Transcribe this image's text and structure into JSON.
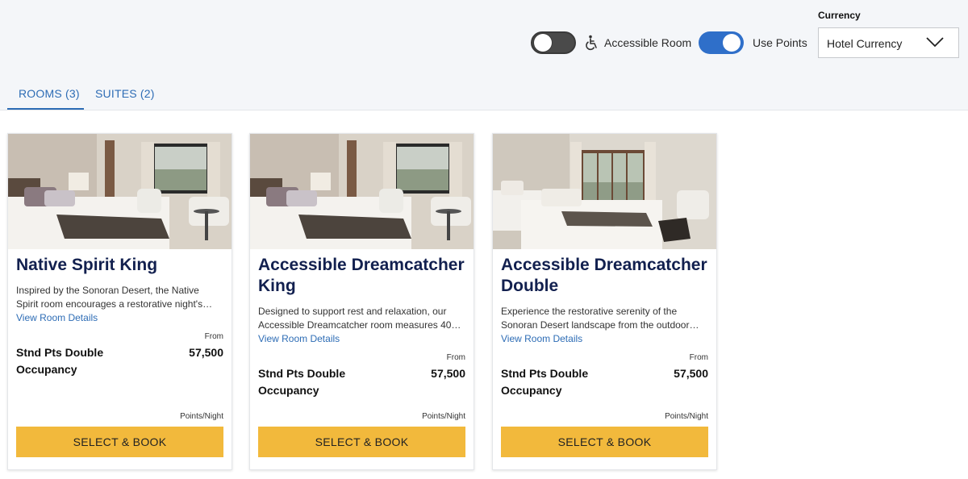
{
  "filters": {
    "accessible_label": "Accessible Room",
    "accessible_on": false,
    "points_label": "Use Points",
    "points_on": true
  },
  "currency": {
    "label": "Currency",
    "value": "Hotel Currency"
  },
  "tabs": [
    {
      "label": "ROOMS (3)",
      "active": true
    },
    {
      "label": "SUITES (2)",
      "active": false
    }
  ],
  "colors": {
    "accent": "#2d6cb5",
    "button": "#f2b93c",
    "title": "#12204f"
  },
  "rooms": [
    {
      "title": "Native Spirit King",
      "desc_lines": [
        "Inspired by the Sonoran Desert, the Native",
        "Spirit room encourages a restorative night's…"
      ],
      "link": "View Room Details",
      "from": "From",
      "rate_lines": [
        "Stnd Pts Double",
        "Occupancy"
      ],
      "points": "57,500",
      "per_night": "Points/Night",
      "button": "SELECT & BOOK"
    },
    {
      "title_lines": [
        "Accessible Dreamcatcher",
        "King"
      ],
      "desc_lines": [
        "Designed to support rest and relaxation, our",
        "Accessible Dreamcatcher room measures 40…"
      ],
      "link": "View Room Details",
      "from": "From",
      "rate_lines": [
        "Stnd Pts Double",
        "Occupancy"
      ],
      "points": "57,500",
      "per_night": "Points/Night",
      "button": "SELECT & BOOK"
    },
    {
      "title_lines": [
        "Accessible Dreamcatcher",
        "Double"
      ],
      "desc_lines": [
        "Experience the restorative serenity of the",
        "Sonoran Desert landscape from the outdoor…"
      ],
      "link": "View Room Details",
      "from": "From",
      "rate_lines": [
        "Stnd Pts Double",
        "Occupancy"
      ],
      "points": "57,500",
      "per_night": "Points/Night",
      "button": "SELECT & BOOK"
    }
  ]
}
